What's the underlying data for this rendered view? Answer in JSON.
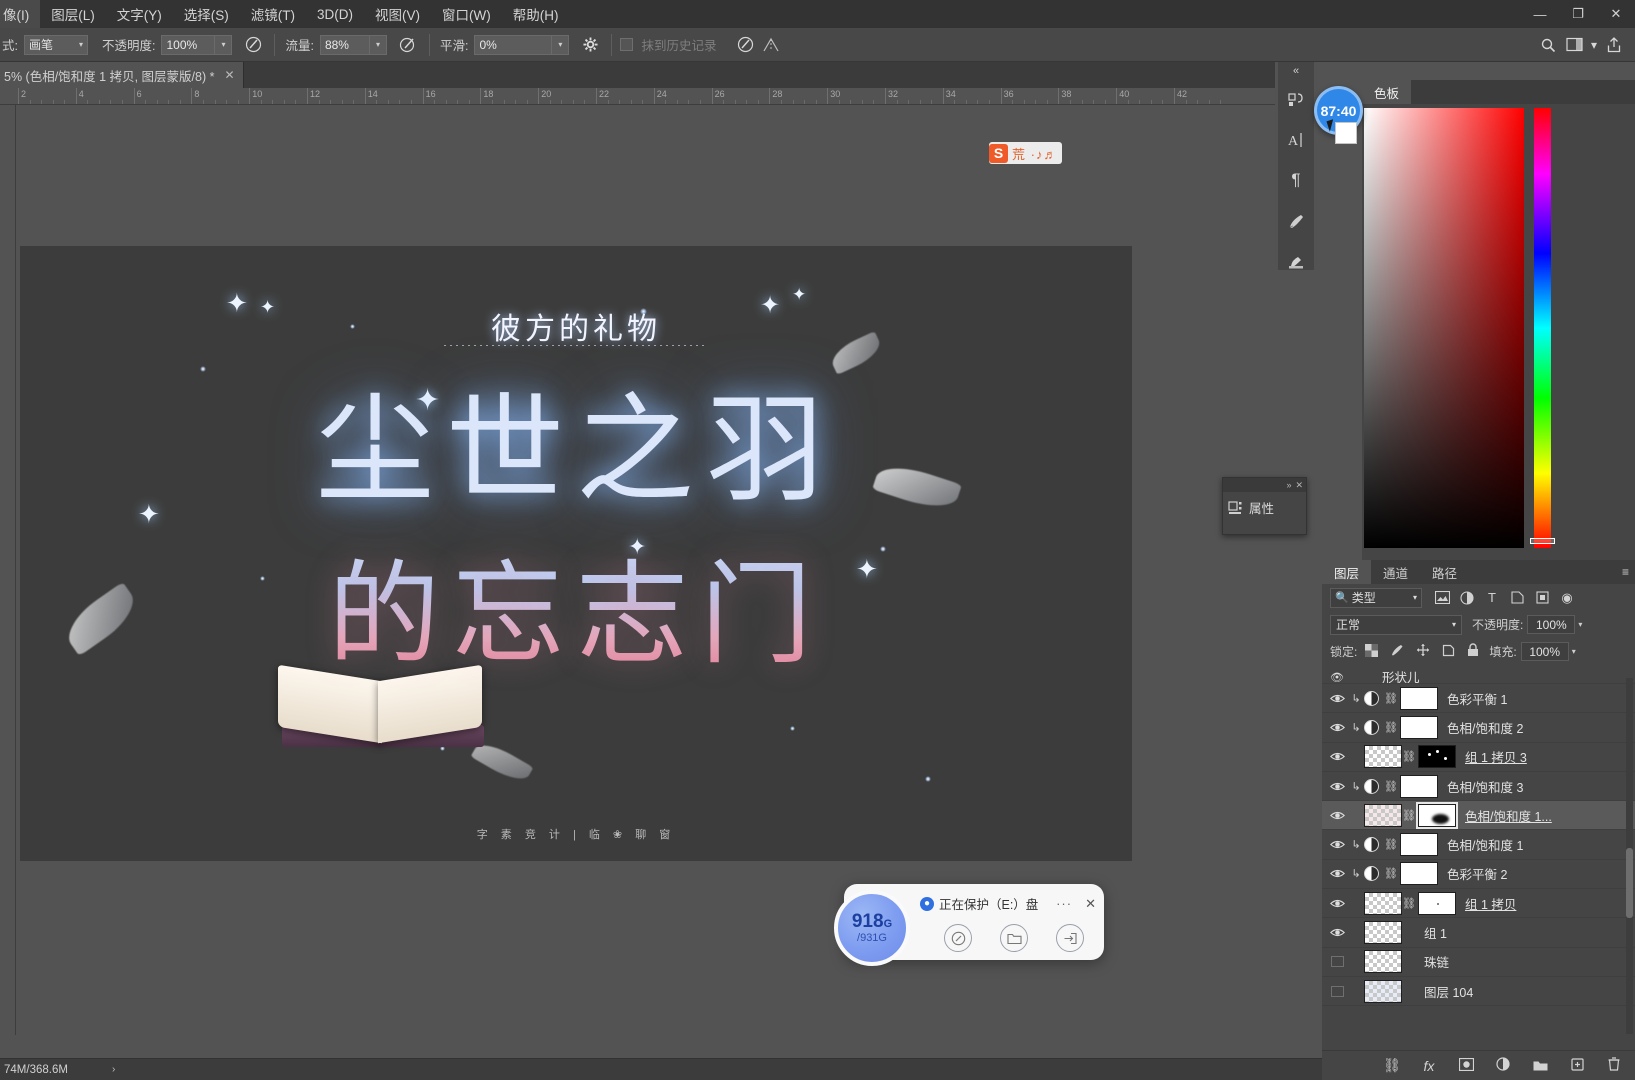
{
  "menubar": {
    "items": [
      "像(I)",
      "图层(L)",
      "文字(Y)",
      "选择(S)",
      "滤镜(T)",
      "3D(D)",
      "视图(V)",
      "窗口(W)",
      "帮助(H)"
    ],
    "window_buttons": {
      "minimize": "—",
      "maximize": "❐",
      "close": "✕"
    }
  },
  "options_bar": {
    "mode_label": "式:",
    "mode_value": "画笔",
    "opacity_label": "不透明度:",
    "opacity_value": "100%",
    "airbrush_icon": "airbrush-icon",
    "flow_label": "流量:",
    "flow_value": "88%",
    "flow_icon": "flow-icon",
    "smoothing_label": "平滑:",
    "smoothing_value": "0%",
    "settings_icon": "gear-icon",
    "erase_history_label": "抹到历史记录",
    "brush_pressure_size_icon": "pressure-size-icon",
    "symmetry_icon": "symmetry-icon",
    "search_icon": "search-icon",
    "workspace_icon": "workspace-icon",
    "share_icon": "share-icon"
  },
  "document_tab": {
    "title": "5% (色相/饱和度 1 拷贝, 图层蒙版/8) *",
    "close": "✕"
  },
  "ruler": {
    "unit_marks": [
      "2",
      "4",
      "6",
      "8",
      "10",
      "12",
      "14",
      "16",
      "18",
      "20",
      "22",
      "24",
      "26",
      "28",
      "30",
      "32",
      "34",
      "36",
      "38",
      "40",
      "42"
    ]
  },
  "artwork": {
    "title": "彼方的礼物",
    "line1": "尘世之羽",
    "line2": "的忘志门",
    "credit": "字 素 竞 计 | 临 ❀ 聊 窗"
  },
  "watermark": {
    "badge": "S",
    "text": "荒 ·♪♬"
  },
  "toolstrip": {
    "items": [
      {
        "name": "character-panel-icon",
        "glyph": "⁋"
      },
      {
        "name": "text-tool-icon",
        "glyph": "A|"
      },
      {
        "name": "paragraph-panel-icon",
        "glyph": "¶"
      },
      {
        "name": "brush-panel-icon",
        "glyph": "✎"
      },
      {
        "name": "clone-source-icon",
        "glyph": "✋"
      }
    ],
    "collapse": "«"
  },
  "color_panel": {
    "tab": "色板",
    "picker": {
      "type": "hsb-square",
      "hue_marker_percent": 4
    }
  },
  "properties_panel": {
    "title": "属性",
    "icon": "properties-icon",
    "collapse": "»",
    "close": "✕"
  },
  "layers_panel": {
    "tabs": [
      "图层",
      "通道",
      "路径"
    ],
    "menu_icon": "panel-menu-icon",
    "filter": {
      "search_icon": "search-icon",
      "type_label": "类型",
      "caret": "⌄",
      "icons": [
        "pixel-filter-icon",
        "adjustment-filter-icon",
        "type-filter-icon",
        "shape-filter-icon",
        "smart-object-filter-icon"
      ],
      "toggle_icon": "filter-toggle-icon"
    },
    "blend_mode": "正常",
    "opacity_label": "不透明度:",
    "opacity_value": "100%",
    "lock_label": "锁定:",
    "lock_icons": [
      "lock-transparent-icon",
      "lock-image-icon",
      "lock-position-icon",
      "lock-artboard-icon",
      "lock-all-icon"
    ],
    "fill_label": "填充:",
    "fill_value": "100%",
    "partial_top_row": "形状儿",
    "layers": [
      {
        "name": "色彩平衡 1",
        "visible": true,
        "clipped": true,
        "kind": "adjustment",
        "thumb": "white",
        "mask": "white",
        "group": false,
        "selected": false
      },
      {
        "name": "色相/饱和度 2",
        "visible": true,
        "clipped": true,
        "kind": "adjustment",
        "thumb": "white",
        "mask": "white",
        "group": false,
        "selected": false
      },
      {
        "name": "组 1 拷贝 3",
        "visible": true,
        "clipped": false,
        "kind": "group",
        "thumb": "checker",
        "mask": "black-dots",
        "group": true,
        "selected": false
      },
      {
        "name": "色相/饱和度 3",
        "visible": true,
        "clipped": true,
        "kind": "adjustment",
        "thumb": "white",
        "mask": "white",
        "group": false,
        "selected": false
      },
      {
        "name": "色相/饱和度 1...",
        "visible": true,
        "clipped": false,
        "kind": "group",
        "thumb": "checker-pink",
        "mask": "blob",
        "group": true,
        "selected": true
      },
      {
        "name": "色相/饱和度 1",
        "visible": true,
        "clipped": true,
        "kind": "adjustment",
        "thumb": "white",
        "mask": "white",
        "group": false,
        "selected": false
      },
      {
        "name": "色彩平衡 2",
        "visible": true,
        "clipped": true,
        "kind": "adjustment",
        "thumb": "white",
        "mask": "white",
        "group": false,
        "selected": false
      },
      {
        "name": "组 1 拷贝",
        "visible": true,
        "clipped": false,
        "kind": "group",
        "thumb": "checker",
        "mask": "dot",
        "group": true,
        "selected": false
      },
      {
        "name": "组 1",
        "visible": true,
        "clipped": false,
        "kind": "group",
        "thumb": "checker",
        "mask": null,
        "group": false,
        "selected": false
      },
      {
        "name": "珠链",
        "visible": false,
        "clipped": false,
        "kind": "layer",
        "thumb": "checker",
        "mask": null,
        "group": false,
        "selected": false
      },
      {
        "name": "图层 104",
        "visible": false,
        "clipped": false,
        "kind": "layer",
        "thumb": "checker-blue",
        "mask": null,
        "group": false,
        "selected": false
      }
    ],
    "footer_icons": [
      "link-layers-icon",
      "layer-style-icon",
      "add-mask-icon",
      "adjustment-layer-icon",
      "new-group-icon",
      "new-layer-icon",
      "delete-layer-icon"
    ]
  },
  "status_bar": {
    "memory": "74M/368.6M",
    "caret": "›"
  },
  "timer_badge": {
    "value": "87:40",
    "color": "#2f87e8"
  },
  "toast": {
    "disk_used": "918",
    "disk_used_unit": "G",
    "disk_total": "/931G",
    "icon": "shield-icon",
    "message": "正在保护（E:）盘",
    "more": "···",
    "close": "✕",
    "actions": [
      "speed-icon",
      "folder-icon",
      "exit-icon"
    ]
  }
}
